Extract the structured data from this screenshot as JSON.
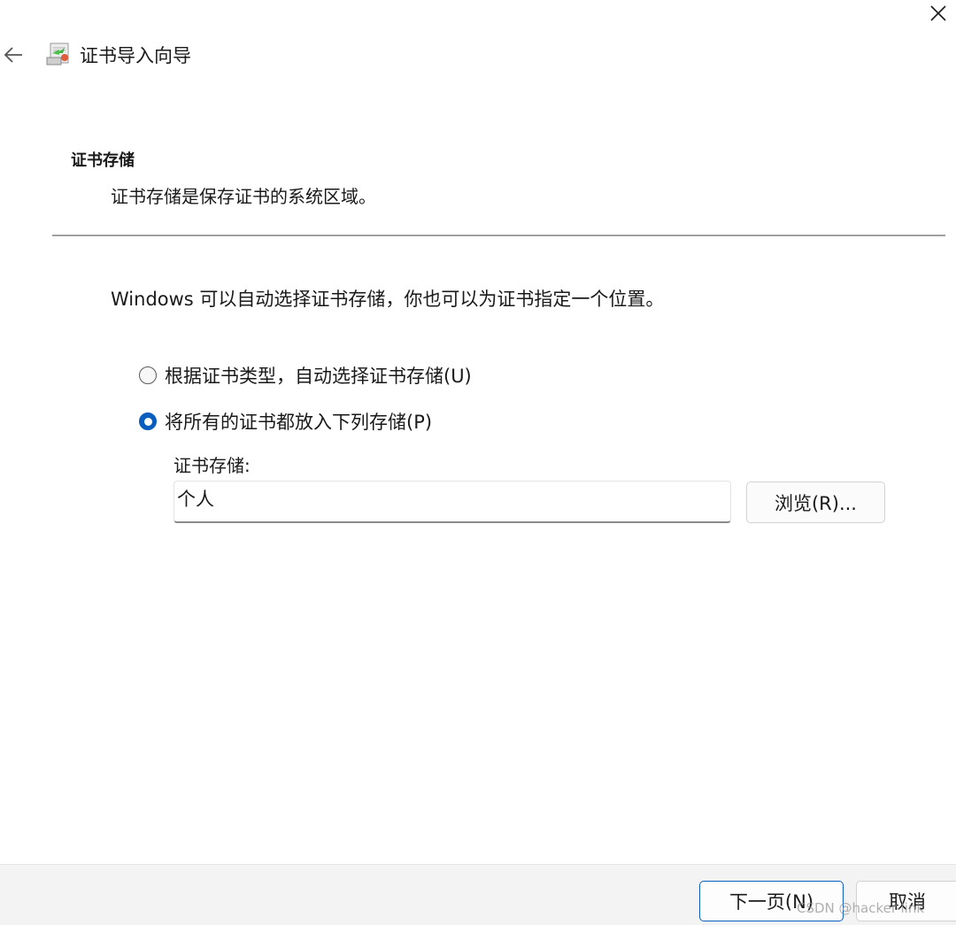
{
  "window": {
    "close_icon": "close-icon"
  },
  "titlebar": {
    "back_icon": "back-arrow-icon",
    "app_icon": "certificate-wizard-icon",
    "title": "证书导入向导"
  },
  "header": {
    "section_title": "证书存储",
    "section_description": "证书存储是保存证书的系统区域。"
  },
  "main": {
    "info_text": "Windows 可以自动选择证书存储，你也可以为证书指定一个位置。",
    "options": [
      {
        "label": "根据证书类型，自动选择证书存储(U)",
        "selected": false
      },
      {
        "label": "将所有的证书都放入下列存储(P)",
        "selected": true
      }
    ],
    "store_label": "证书存储:",
    "store_value": "个人",
    "browse_label": "浏览(R)..."
  },
  "footer": {
    "next_label": "下一页(N)",
    "cancel_label": "取消"
  },
  "watermark": "CSDN @hacker-link",
  "colors": {
    "accent": "#0a5ebd",
    "footer_bg": "#f3f3f3",
    "divider": "#a0a0a0"
  }
}
